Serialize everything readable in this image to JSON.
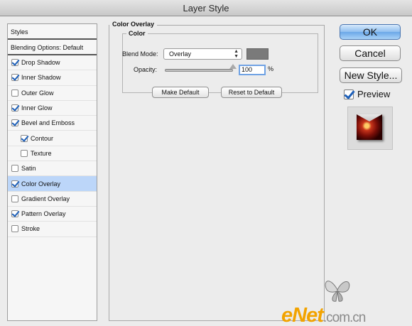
{
  "window": {
    "title": "Layer Style"
  },
  "sidebar": {
    "header": "Styles",
    "blending_options": "Blending Options: Default",
    "items": [
      {
        "label": "Drop Shadow",
        "checked": true,
        "indent": false,
        "selected": false
      },
      {
        "label": "Inner Shadow",
        "checked": true,
        "indent": false,
        "selected": false
      },
      {
        "label": "Outer Glow",
        "checked": false,
        "indent": false,
        "selected": false
      },
      {
        "label": "Inner Glow",
        "checked": true,
        "indent": false,
        "selected": false
      },
      {
        "label": "Bevel and Emboss",
        "checked": true,
        "indent": false,
        "selected": false
      },
      {
        "label": "Contour",
        "checked": true,
        "indent": true,
        "selected": false
      },
      {
        "label": "Texture",
        "checked": false,
        "indent": true,
        "selected": false
      },
      {
        "label": "Satin",
        "checked": false,
        "indent": false,
        "selected": false
      },
      {
        "label": "Color Overlay",
        "checked": true,
        "indent": false,
        "selected": true
      },
      {
        "label": "Gradient Overlay",
        "checked": false,
        "indent": false,
        "selected": false
      },
      {
        "label": "Pattern Overlay",
        "checked": true,
        "indent": false,
        "selected": false
      },
      {
        "label": "Stroke",
        "checked": false,
        "indent": false,
        "selected": false
      }
    ]
  },
  "panel": {
    "title": "Color Overlay",
    "group_title": "Color",
    "blend_mode_label": "Blend Mode:",
    "blend_mode_value": "Overlay",
    "swatch_color": "#7a7a7a",
    "opacity_label": "Opacity:",
    "opacity_value": "100",
    "opacity_unit": "%",
    "make_default": "Make Default",
    "reset_default": "Reset to Default"
  },
  "actions": {
    "ok": "OK",
    "cancel": "Cancel",
    "new_style": "New Style...",
    "preview_label": "Preview",
    "preview_checked": true
  },
  "watermark": {
    "brand": "eNet",
    "suffix": ".com.cn"
  }
}
